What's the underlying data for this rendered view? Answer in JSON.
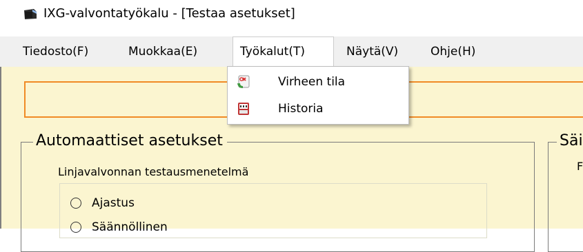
{
  "window": {
    "title": "IXG-valvontatyökalu - [Testaa asetukset]",
    "icon": "camera-app-icon"
  },
  "menubar": {
    "items": [
      {
        "id": "file",
        "label": "Tiedosto(F)"
      },
      {
        "id": "edit",
        "label": "Muokkaa(E)"
      },
      {
        "id": "tools",
        "label": "Työkalut(T)",
        "open": true
      },
      {
        "id": "view",
        "label": "Näytä(V)"
      },
      {
        "id": "help",
        "label": "Ohje(H)"
      }
    ]
  },
  "tools_menu": {
    "items": [
      {
        "label": "Virheen tila",
        "icon": "error-status-icon"
      },
      {
        "label": "Historia",
        "icon": "history-log-icon"
      }
    ]
  },
  "main": {
    "auto_group": {
      "title": "Automaattiset asetukset",
      "method_label": "Linjavalvonnan testausmenetelmä",
      "options": [
        {
          "label": "Ajastus",
          "selected": false
        },
        {
          "label": "Säännöllinen",
          "selected": false
        }
      ]
    },
    "safety_group": {
      "title": "Säi",
      "first_letter": "F"
    }
  },
  "colors": {
    "main_background": "#fbf5d0",
    "alert_border": "#f08a24",
    "menubar_background": "#f0f0f0"
  }
}
